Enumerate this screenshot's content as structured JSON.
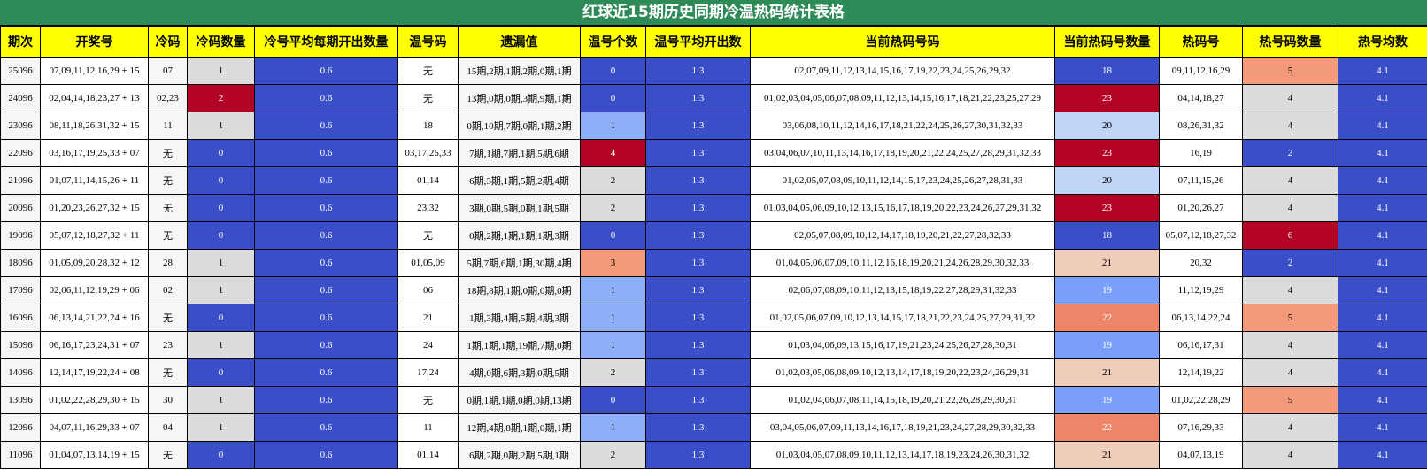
{
  "title": "红球近15期历史同期冷温热码统计表格",
  "headers": [
    "期次",
    "开奖号",
    "冷码",
    "冷码数量",
    "冷号平均每期开出数量",
    "温号码",
    "遗漏值",
    "温号个数",
    "温号平均开出数",
    "当前热码号码",
    "当前热码号数量",
    "热码号",
    "热号码数量",
    "热号均数"
  ],
  "rows": [
    [
      "25096",
      "07,09,11,12,16,29 + 15",
      "07",
      "1",
      "0.6",
      "无",
      "15期,2期,1期,2期,0期,1期",
      "0",
      "1.3",
      "02,07,09,11,12,13,14,15,16,17,19,22,23,24,25,26,29,32",
      "18",
      "09,11,12,16,29",
      "5",
      "4.1"
    ],
    [
      "24096",
      "02,04,14,18,23,27 + 13",
      "02,23",
      "2",
      "0.6",
      "无",
      "13期,0期,0期,3期,9期,1期",
      "0",
      "1.3",
      "01,02,03,04,05,06,07,08,09,11,12,13,14,15,16,17,18,21,22,23,25,27,29",
      "23",
      "04,14,18,27",
      "4",
      "4.1"
    ],
    [
      "23096",
      "08,11,18,26,31,32 + 15",
      "11",
      "1",
      "0.6",
      "18",
      "0期,10期,7期,0期,1期,2期",
      "1",
      "1.3",
      "03,06,08,10,11,12,14,16,17,18,21,22,24,25,26,27,30,31,32,33",
      "20",
      "08,26,31,32",
      "4",
      "4.1"
    ],
    [
      "22096",
      "03,16,17,19,25,33 + 07",
      "无",
      "0",
      "0.6",
      "03,17,25,33",
      "7期,1期,7期,1期,5期,6期",
      "4",
      "1.3",
      "03,04,06,07,10,11,13,14,16,17,18,19,20,21,22,24,25,27,28,29,31,32,33",
      "23",
      "16,19",
      "2",
      "4.1"
    ],
    [
      "21096",
      "01,07,11,14,15,26 + 11",
      "无",
      "0",
      "0.6",
      "01,14",
      "6期,3期,1期,5期,2期,4期",
      "2",
      "1.3",
      "01,02,05,07,08,09,10,11,12,14,15,17,23,24,25,26,27,28,31,33",
      "20",
      "07,11,15,26",
      "4",
      "4.1"
    ],
    [
      "20096",
      "01,20,23,26,27,32 + 15",
      "无",
      "0",
      "0.6",
      "23,32",
      "3期,0期,5期,0期,1期,5期",
      "2",
      "1.3",
      "01,03,04,05,06,09,10,12,13,15,16,17,18,19,20,22,23,24,26,27,29,31,32",
      "23",
      "01,20,26,27",
      "4",
      "4.1"
    ],
    [
      "19096",
      "05,07,12,18,27,32 + 11",
      "无",
      "0",
      "0.6",
      "无",
      "0期,2期,1期,1期,1期,3期",
      "0",
      "1.3",
      "02,05,07,08,09,10,12,14,17,18,19,20,21,22,27,28,32,33",
      "18",
      "05,07,12,18,27,32",
      "6",
      "4.1"
    ],
    [
      "18096",
      "01,05,09,20,28,32 + 12",
      "28",
      "1",
      "0.6",
      "01,05,09",
      "5期,7期,6期,1期,30期,4期",
      "3",
      "1.3",
      "01,04,05,06,07,09,10,11,12,16,18,19,20,21,24,26,28,29,30,32,33",
      "21",
      "20,32",
      "2",
      "4.1"
    ],
    [
      "17096",
      "02,06,11,12,19,29 + 06",
      "02",
      "1",
      "0.6",
      "06",
      "18期,8期,1期,0期,0期,0期",
      "1",
      "1.3",
      "02,06,07,08,09,10,11,12,13,15,18,19,22,27,28,29,31,32,33",
      "19",
      "11,12,19,29",
      "4",
      "4.1"
    ],
    [
      "16096",
      "06,13,14,21,22,24 + 16",
      "无",
      "0",
      "0.6",
      "21",
      "1期,3期,4期,5期,4期,3期",
      "1",
      "1.3",
      "01,02,05,06,07,09,10,12,13,14,15,17,18,21,22,23,24,25,27,29,31,32",
      "22",
      "06,13,14,22,24",
      "5",
      "4.1"
    ],
    [
      "15096",
      "06,16,17,23,24,31 + 07",
      "23",
      "1",
      "0.6",
      "24",
      "1期,1期,1期,19期,7期,0期",
      "1",
      "1.3",
      "01,03,04,06,09,13,15,16,17,19,21,23,24,25,26,27,28,30,31",
      "19",
      "06,16,17,31",
      "4",
      "4.1"
    ],
    [
      "14096",
      "12,14,17,19,22,24 + 08",
      "无",
      "0",
      "0.6",
      "17,24",
      "4期,0期,6期,3期,0期,5期",
      "2",
      "1.3",
      "01,02,03,05,06,08,09,10,12,13,14,17,18,19,20,22,23,24,26,29,31",
      "21",
      "12,14,19,22",
      "4",
      "4.1"
    ],
    [
      "13096",
      "01,02,22,28,29,30 + 15",
      "30",
      "1",
      "0.6",
      "无",
      "0期,1期,1期,0期,0期,13期",
      "0",
      "1.3",
      "01,02,04,06,07,08,11,14,15,18,19,20,21,22,26,28,29,30,31",
      "19",
      "01,02,22,28,29",
      "5",
      "4.1"
    ],
    [
      "12096",
      "04,07,11,16,29,33 + 07",
      "04",
      "1",
      "0.6",
      "11",
      "12期,4期,8期,1期,0期,1期",
      "1",
      "1.3",
      "03,04,05,06,07,09,11,13,14,16,17,18,19,21,23,24,27,28,29,30,32,33",
      "22",
      "07,16,29,33",
      "4",
      "4.1"
    ],
    [
      "11096",
      "01,04,07,13,14,19 + 15",
      "无",
      "0",
      "0.6",
      "01,14",
      "6期,2期,0期,2期,5期,1期",
      "2",
      "1.3",
      "01,03,04,05,07,08,09,10,11,12,13,14,17,18,19,23,24,26,30,31,32",
      "21",
      "04,07,13,19",
      "4",
      "4.1"
    ]
  ],
  "cell_colors": {
    "cold_count": {
      "0": "#3a4ec8",
      "1": "#dcdcdc",
      "2": "#b40426"
    },
    "warm_count": {
      "0": "#3a4ec8",
      "1": "#8daff8",
      "2": "#dcdcdc",
      "3": "#f49a7b",
      "4": "#b40426"
    },
    "hot_now_count": {
      "18": "#3a4ec8",
      "19": "#7b9ff9",
      "20": "#c0d4f5",
      "21": "#f0cdbb",
      "22": "#ee8468",
      "23": "#b40426"
    },
    "hot_count": {
      "2": "#3a4ec8",
      "4": "#dcdcdc",
      "5": "#f49a7b",
      "6": "#b40426"
    },
    "average": "#3a4ec8",
    "title_bar": "#2e8b57",
    "header": "#ffff00"
  }
}
